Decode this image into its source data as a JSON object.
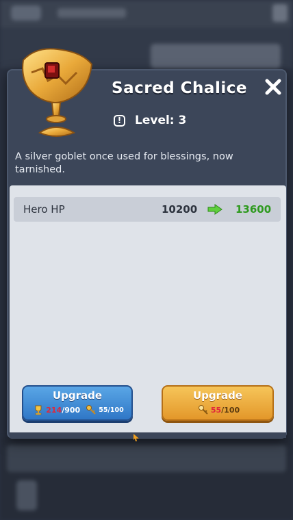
{
  "item": {
    "name": "Sacred Chalice",
    "level_text": "Level: 3",
    "description": "A silver goblet once used for blessings, now tarnished.",
    "icon": "chalice-icon",
    "info_icon_glyph": "!"
  },
  "close": {
    "glyph": "✖"
  },
  "stats": [
    {
      "name": "Hero HP",
      "current": "10200",
      "next": "13600"
    }
  ],
  "upgrade_buttons": [
    {
      "label": "Upgrade",
      "cost_primary_have": "214",
      "cost_primary_sep": "/900",
      "cost_secondary": "55/100",
      "color": "#3b8ad8"
    },
    {
      "label": "Upgrade",
      "cost_have": "55",
      "cost_sep": "/100",
      "color": "#eeb145"
    }
  ],
  "colors": {
    "modal_bg": "#3c4659",
    "panel_bg": "#dfe3e9",
    "stat_next": "#2e9a1e",
    "cost_insufficient": "#e0283c"
  }
}
